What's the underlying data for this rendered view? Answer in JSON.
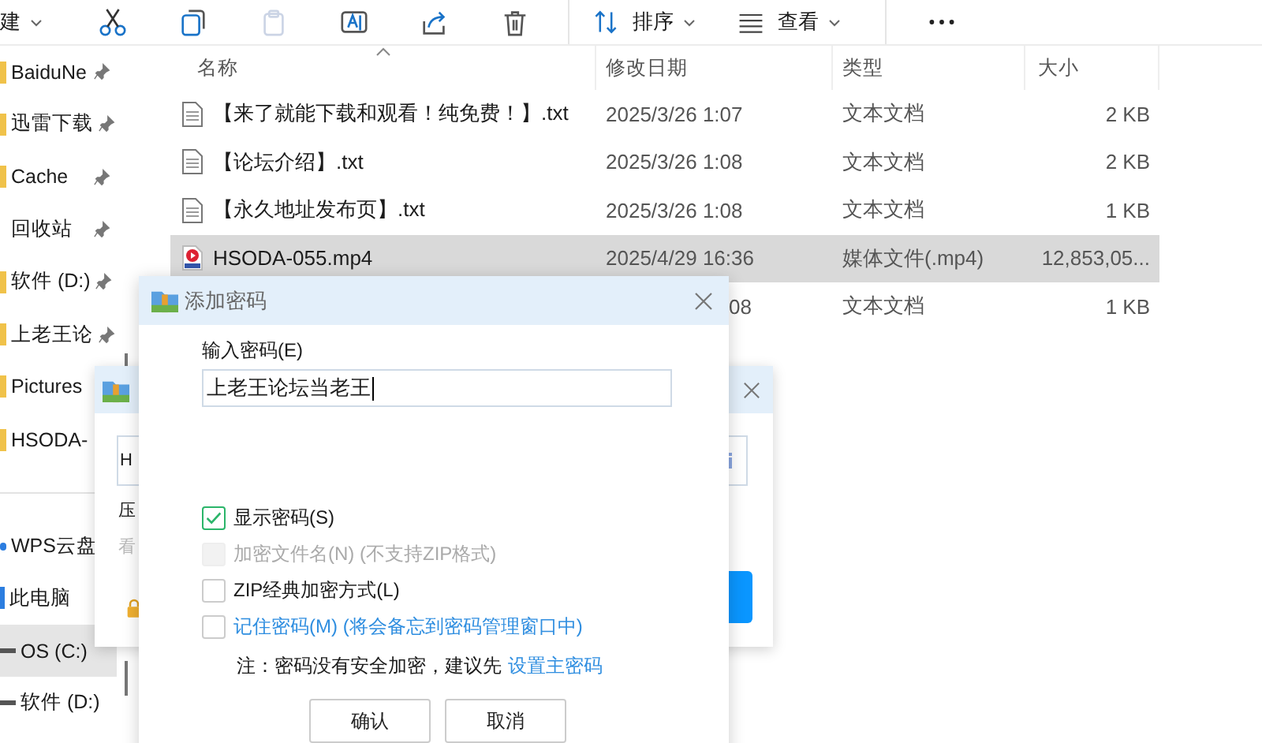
{
  "toolbar": {
    "new_label": "建",
    "actions": [
      {
        "kind": "cut",
        "disabled": false
      },
      {
        "kind": "copy",
        "disabled": false
      },
      {
        "kind": "paste",
        "disabled": true
      },
      {
        "kind": "rename",
        "disabled": false
      },
      {
        "kind": "share",
        "disabled": false
      },
      {
        "kind": "delete",
        "disabled": false
      }
    ],
    "sort_label": "排序",
    "view_label": "查看"
  },
  "sidebar": {
    "pinned": [
      {
        "label": "BaiduNe",
        "kind": "folder",
        "pinned": true,
        "selected": false
      },
      {
        "label": "迅雷下载",
        "kind": "folder",
        "pinned": true,
        "selected": false
      },
      {
        "label": "Cache",
        "kind": "folder",
        "pinned": true,
        "selected": false
      },
      {
        "label": "回收站",
        "kind": "recycle",
        "pinned": true,
        "selected": false
      },
      {
        "label": "软件 (D:)",
        "kind": "folder",
        "pinned": true,
        "selected": false
      },
      {
        "label": "上老王论",
        "kind": "folder",
        "pinned": true,
        "selected": false
      },
      {
        "label": "Pictures",
        "kind": "folder",
        "pinned": false,
        "selected": false
      },
      {
        "label": "HSODA-",
        "kind": "folder",
        "pinned": false,
        "selected": false
      }
    ],
    "places": [
      {
        "label": "WPS云盘",
        "kind": "cloud",
        "pinned": false,
        "selected": false
      },
      {
        "label": "此电脑",
        "kind": "pc",
        "pinned": false,
        "selected": false
      },
      {
        "label": "OS (C:)",
        "kind": "drive",
        "pinned": false,
        "selected": true
      },
      {
        "label": "软件 (D:)",
        "kind": "drive",
        "pinned": false,
        "selected": false
      }
    ]
  },
  "file_list": {
    "columns": [
      {
        "label": "名称",
        "sorted": true
      },
      {
        "label": "修改日期",
        "sorted": false
      },
      {
        "label": "类型",
        "sorted": false
      },
      {
        "label": "大小",
        "sorted": false
      }
    ],
    "rows": [
      {
        "kind": "text",
        "name": "【来了就能下载和观看！纯免费！】.txt",
        "date": "2025/3/26 1:07",
        "type": "文本文档",
        "size": "2 KB",
        "selected": false
      },
      {
        "kind": "text",
        "name": "【论坛介绍】.txt",
        "date": "2025/3/26 1:08",
        "type": "文本文档",
        "size": "2 KB",
        "selected": false
      },
      {
        "kind": "text",
        "name": "【永久地址发布页】.txt",
        "date": "2025/3/26 1:08",
        "type": "文本文档",
        "size": "1 KB",
        "selected": false
      },
      {
        "kind": "video",
        "name": "HSODA-055.mp4",
        "date": "2025/4/29 16:36",
        "type": "媒体文件(.mp4)",
        "size": "12,853,05...",
        "selected": true
      },
      {
        "kind": "covered",
        "date": "08",
        "type": "文本文档",
        "size": "1 KB",
        "selected": false
      }
    ]
  },
  "back_dialog": {
    "field_value": "H",
    "labels": [
      {
        "text": "压",
        "disabled": false
      },
      {
        "text": "看",
        "disabled": true
      }
    ]
  },
  "dialog": {
    "title": "添加密码",
    "password_label": "输入密码(E)",
    "password_value": "上老王论坛当老王",
    "options": [
      {
        "label": "显示密码(S)",
        "checked": true,
        "disabled": false,
        "link": false
      },
      {
        "label": "加密文件名(N) (不支持ZIP格式)",
        "checked": false,
        "disabled": true,
        "link": false
      },
      {
        "label": "ZIP经典加密方式(L)",
        "checked": false,
        "disabled": false,
        "link": false
      },
      {
        "label": "记住密码(M) (将会备忘到密码管理窗口中)",
        "checked": false,
        "disabled": false,
        "link": true
      }
    ],
    "note": "注：密码没有安全加密，建议先",
    "note_link": "设置主密码",
    "buttons": [
      "确认",
      "取消"
    ]
  }
}
